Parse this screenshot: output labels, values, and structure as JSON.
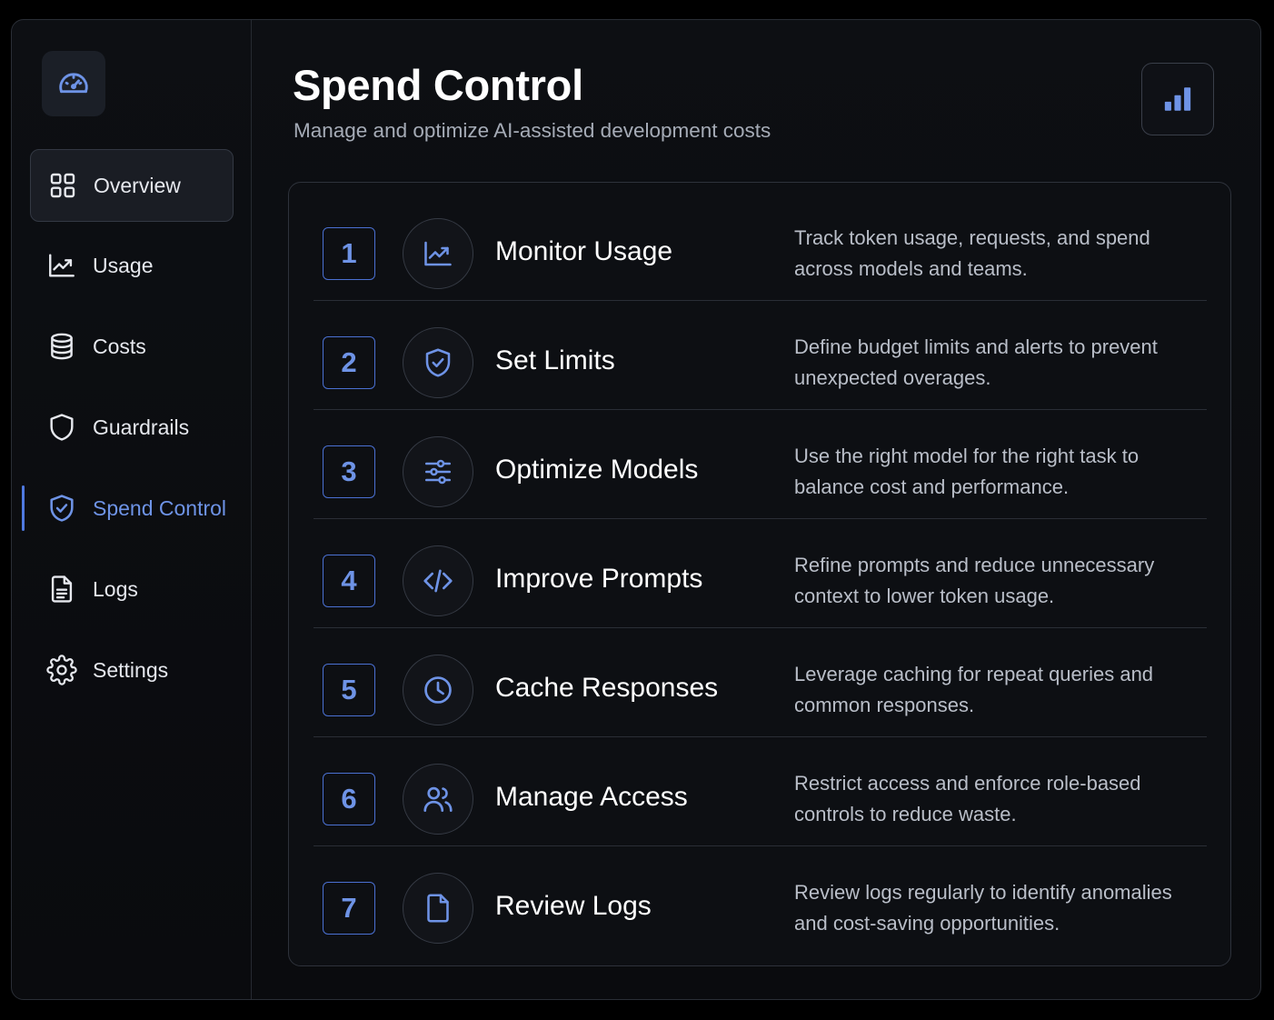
{
  "app": {
    "logo_icon": "speedometer-icon"
  },
  "sidebar": {
    "items": [
      {
        "label": "Overview",
        "icon": "grid-icon",
        "state": "active"
      },
      {
        "label": "Usage",
        "icon": "line-chart-icon",
        "state": "default"
      },
      {
        "label": "Costs",
        "icon": "database-icon",
        "state": "default"
      },
      {
        "label": "Guardrails",
        "icon": "shield-icon",
        "state": "default"
      },
      {
        "label": "Spend Control",
        "icon": "shield-check-icon",
        "state": "current"
      },
      {
        "label": "Logs",
        "icon": "document-icon",
        "state": "default"
      },
      {
        "label": "Settings",
        "icon": "gear-icon",
        "state": "default"
      }
    ]
  },
  "header": {
    "title": "Spend Control",
    "subtitle": "Manage and optimize AI-assisted development costs",
    "action_icon": "bar-chart-icon"
  },
  "steps": [
    {
      "number": "1",
      "icon": "trend-chart-icon",
      "title": "Monitor Usage",
      "description": "Track token usage, requests, and spend across models and teams."
    },
    {
      "number": "2",
      "icon": "shield-check-icon",
      "title": "Set Limits",
      "description": "Define budget limits and alerts to prevent unexpected overages."
    },
    {
      "number": "3",
      "icon": "sliders-icon",
      "title": "Optimize Models",
      "description": "Use the right model for the right task to balance cost and performance."
    },
    {
      "number": "4",
      "icon": "code-icon",
      "title": "Improve Prompts",
      "description": "Refine prompts and reduce unnecessary context to lower token usage."
    },
    {
      "number": "5",
      "icon": "clock-icon",
      "title": "Cache Responses",
      "description": "Leverage caching for repeat queries and common responses."
    },
    {
      "number": "6",
      "icon": "users-icon",
      "title": "Manage Access",
      "description": "Restrict access and enforce role-based controls to reduce waste."
    },
    {
      "number": "7",
      "icon": "file-icon",
      "title": "Review Logs",
      "description": "Review logs regularly to identify anomalies and cost-saving opportunities."
    }
  ],
  "colors": {
    "accent": "#6e93e6",
    "background": "#0a0b0e",
    "border": "#2e323b",
    "text": "#ffffff",
    "muted_text": "#b9bec8"
  }
}
